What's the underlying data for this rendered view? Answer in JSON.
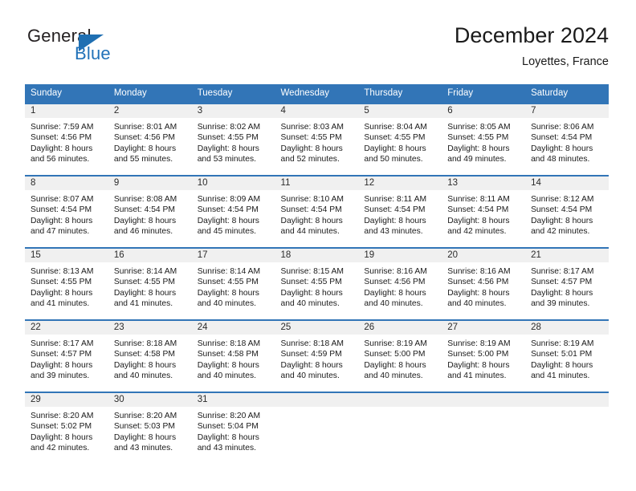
{
  "brand": {
    "name_top": "General",
    "name_bottom": "Blue",
    "color_dark": "#231f20",
    "color_blue": "#2272b9",
    "triangle_icon": "triangle-icon"
  },
  "header": {
    "title": "December 2024",
    "subtitle": "Loyettes, France"
  },
  "theme": {
    "header_blue": "#3275b7",
    "daynum_band": "#f0f0f0",
    "text": "#1a1a1a"
  },
  "calendar": {
    "weekday_headers": [
      "Sunday",
      "Monday",
      "Tuesday",
      "Wednesday",
      "Thursday",
      "Friday",
      "Saturday"
    ],
    "weeks": [
      [
        {
          "day": "1",
          "sunrise": "Sunrise: 7:59 AM",
          "sunset": "Sunset: 4:56 PM",
          "daylight_line1": "Daylight: 8 hours",
          "daylight_line2": "and 56 minutes."
        },
        {
          "day": "2",
          "sunrise": "Sunrise: 8:01 AM",
          "sunset": "Sunset: 4:56 PM",
          "daylight_line1": "Daylight: 8 hours",
          "daylight_line2": "and 55 minutes."
        },
        {
          "day": "3",
          "sunrise": "Sunrise: 8:02 AM",
          "sunset": "Sunset: 4:55 PM",
          "daylight_line1": "Daylight: 8 hours",
          "daylight_line2": "and 53 minutes."
        },
        {
          "day": "4",
          "sunrise": "Sunrise: 8:03 AM",
          "sunset": "Sunset: 4:55 PM",
          "daylight_line1": "Daylight: 8 hours",
          "daylight_line2": "and 52 minutes."
        },
        {
          "day": "5",
          "sunrise": "Sunrise: 8:04 AM",
          "sunset": "Sunset: 4:55 PM",
          "daylight_line1": "Daylight: 8 hours",
          "daylight_line2": "and 50 minutes."
        },
        {
          "day": "6",
          "sunrise": "Sunrise: 8:05 AM",
          "sunset": "Sunset: 4:55 PM",
          "daylight_line1": "Daylight: 8 hours",
          "daylight_line2": "and 49 minutes."
        },
        {
          "day": "7",
          "sunrise": "Sunrise: 8:06 AM",
          "sunset": "Sunset: 4:54 PM",
          "daylight_line1": "Daylight: 8 hours",
          "daylight_line2": "and 48 minutes."
        }
      ],
      [
        {
          "day": "8",
          "sunrise": "Sunrise: 8:07 AM",
          "sunset": "Sunset: 4:54 PM",
          "daylight_line1": "Daylight: 8 hours",
          "daylight_line2": "and 47 minutes."
        },
        {
          "day": "9",
          "sunrise": "Sunrise: 8:08 AM",
          "sunset": "Sunset: 4:54 PM",
          "daylight_line1": "Daylight: 8 hours",
          "daylight_line2": "and 46 minutes."
        },
        {
          "day": "10",
          "sunrise": "Sunrise: 8:09 AM",
          "sunset": "Sunset: 4:54 PM",
          "daylight_line1": "Daylight: 8 hours",
          "daylight_line2": "and 45 minutes."
        },
        {
          "day": "11",
          "sunrise": "Sunrise: 8:10 AM",
          "sunset": "Sunset: 4:54 PM",
          "daylight_line1": "Daylight: 8 hours",
          "daylight_line2": "and 44 minutes."
        },
        {
          "day": "12",
          "sunrise": "Sunrise: 8:11 AM",
          "sunset": "Sunset: 4:54 PM",
          "daylight_line1": "Daylight: 8 hours",
          "daylight_line2": "and 43 minutes."
        },
        {
          "day": "13",
          "sunrise": "Sunrise: 8:11 AM",
          "sunset": "Sunset: 4:54 PM",
          "daylight_line1": "Daylight: 8 hours",
          "daylight_line2": "and 42 minutes."
        },
        {
          "day": "14",
          "sunrise": "Sunrise: 8:12 AM",
          "sunset": "Sunset: 4:54 PM",
          "daylight_line1": "Daylight: 8 hours",
          "daylight_line2": "and 42 minutes."
        }
      ],
      [
        {
          "day": "15",
          "sunrise": "Sunrise: 8:13 AM",
          "sunset": "Sunset: 4:55 PM",
          "daylight_line1": "Daylight: 8 hours",
          "daylight_line2": "and 41 minutes."
        },
        {
          "day": "16",
          "sunrise": "Sunrise: 8:14 AM",
          "sunset": "Sunset: 4:55 PM",
          "daylight_line1": "Daylight: 8 hours",
          "daylight_line2": "and 41 minutes."
        },
        {
          "day": "17",
          "sunrise": "Sunrise: 8:14 AM",
          "sunset": "Sunset: 4:55 PM",
          "daylight_line1": "Daylight: 8 hours",
          "daylight_line2": "and 40 minutes."
        },
        {
          "day": "18",
          "sunrise": "Sunrise: 8:15 AM",
          "sunset": "Sunset: 4:55 PM",
          "daylight_line1": "Daylight: 8 hours",
          "daylight_line2": "and 40 minutes."
        },
        {
          "day": "19",
          "sunrise": "Sunrise: 8:16 AM",
          "sunset": "Sunset: 4:56 PM",
          "daylight_line1": "Daylight: 8 hours",
          "daylight_line2": "and 40 minutes."
        },
        {
          "day": "20",
          "sunrise": "Sunrise: 8:16 AM",
          "sunset": "Sunset: 4:56 PM",
          "daylight_line1": "Daylight: 8 hours",
          "daylight_line2": "and 40 minutes."
        },
        {
          "day": "21",
          "sunrise": "Sunrise: 8:17 AM",
          "sunset": "Sunset: 4:57 PM",
          "daylight_line1": "Daylight: 8 hours",
          "daylight_line2": "and 39 minutes."
        }
      ],
      [
        {
          "day": "22",
          "sunrise": "Sunrise: 8:17 AM",
          "sunset": "Sunset: 4:57 PM",
          "daylight_line1": "Daylight: 8 hours",
          "daylight_line2": "and 39 minutes."
        },
        {
          "day": "23",
          "sunrise": "Sunrise: 8:18 AM",
          "sunset": "Sunset: 4:58 PM",
          "daylight_line1": "Daylight: 8 hours",
          "daylight_line2": "and 40 minutes."
        },
        {
          "day": "24",
          "sunrise": "Sunrise: 8:18 AM",
          "sunset": "Sunset: 4:58 PM",
          "daylight_line1": "Daylight: 8 hours",
          "daylight_line2": "and 40 minutes."
        },
        {
          "day": "25",
          "sunrise": "Sunrise: 8:18 AM",
          "sunset": "Sunset: 4:59 PM",
          "daylight_line1": "Daylight: 8 hours",
          "daylight_line2": "and 40 minutes."
        },
        {
          "day": "26",
          "sunrise": "Sunrise: 8:19 AM",
          "sunset": "Sunset: 5:00 PM",
          "daylight_line1": "Daylight: 8 hours",
          "daylight_line2": "and 40 minutes."
        },
        {
          "day": "27",
          "sunrise": "Sunrise: 8:19 AM",
          "sunset": "Sunset: 5:00 PM",
          "daylight_line1": "Daylight: 8 hours",
          "daylight_line2": "and 41 minutes."
        },
        {
          "day": "28",
          "sunrise": "Sunrise: 8:19 AM",
          "sunset": "Sunset: 5:01 PM",
          "daylight_line1": "Daylight: 8 hours",
          "daylight_line2": "and 41 minutes."
        }
      ],
      [
        {
          "day": "29",
          "sunrise": "Sunrise: 8:20 AM",
          "sunset": "Sunset: 5:02 PM",
          "daylight_line1": "Daylight: 8 hours",
          "daylight_line2": "and 42 minutes."
        },
        {
          "day": "30",
          "sunrise": "Sunrise: 8:20 AM",
          "sunset": "Sunset: 5:03 PM",
          "daylight_line1": "Daylight: 8 hours",
          "daylight_line2": "and 43 minutes."
        },
        {
          "day": "31",
          "sunrise": "Sunrise: 8:20 AM",
          "sunset": "Sunset: 5:04 PM",
          "daylight_line1": "Daylight: 8 hours",
          "daylight_line2": "and 43 minutes."
        },
        {
          "day": "",
          "sunrise": "",
          "sunset": "",
          "daylight_line1": "",
          "daylight_line2": ""
        },
        {
          "day": "",
          "sunrise": "",
          "sunset": "",
          "daylight_line1": "",
          "daylight_line2": ""
        },
        {
          "day": "",
          "sunrise": "",
          "sunset": "",
          "daylight_line1": "",
          "daylight_line2": ""
        },
        {
          "day": "",
          "sunrise": "",
          "sunset": "",
          "daylight_line1": "",
          "daylight_line2": ""
        }
      ]
    ]
  }
}
